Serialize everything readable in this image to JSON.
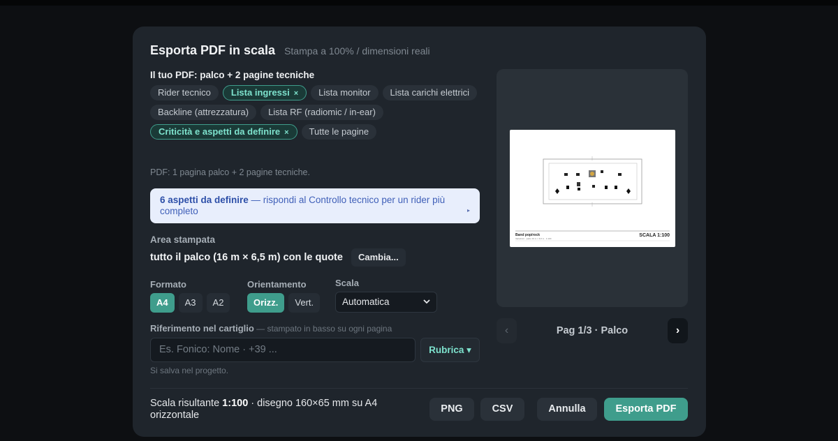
{
  "dialog": {
    "title": "Esporta PDF in scala",
    "subtitle": "Stampa a 100% / dimensioni reali",
    "pdf_section_label": "Il tuo PDF: palco + 2 pagine tecniche",
    "chips": [
      {
        "label": "Rider tecnico",
        "active": false
      },
      {
        "label": "Lista ingressi",
        "active": true
      },
      {
        "label": "Lista monitor",
        "active": false
      },
      {
        "label": "Lista carichi elettrici",
        "active": false
      },
      {
        "label": "Backline (attrezzatura)",
        "active": false
      },
      {
        "label": "Lista RF (radiomic / in-ear)",
        "active": false
      },
      {
        "label": "Criticità e aspetti da definire",
        "active": true
      },
      {
        "label": "Tutte le pagine",
        "active": false
      }
    ],
    "chip_remove_glyph": "×",
    "pdf_info": "PDF: 1 pagina palco + 2 pagine tecniche.",
    "alert": {
      "bold": "6 aspetti da definire",
      "text": " — rispondi al Controllo tecnico per un rider più completo",
      "arrow": "▸"
    },
    "area": {
      "label": "Area stampata",
      "value": "tutto il palco (16 m × 6,5 m) con le quote",
      "change_label": "Cambia..."
    },
    "format": {
      "label": "Formato",
      "options": [
        "A4",
        "A3",
        "A2"
      ],
      "selected": "A4"
    },
    "orientation": {
      "label": "Orientamento",
      "options": [
        "Orizz.",
        "Vert."
      ],
      "selected": "Orizz."
    },
    "scale": {
      "label": "Scala",
      "value": "Automatica"
    },
    "reference": {
      "label": "Riferimento nel cartiglio",
      "hint": " — stampato in basso su ogni pagina",
      "placeholder": "Es. Fonico: Nome · +39 ...",
      "rubrica_label": "Rubrica ▾",
      "save_note": "Si salva nel progetto."
    },
    "preview": {
      "sheet_title": "Band pop/rock",
      "sheet_sub": "Variazioni · palco 16 m × 6,5 m · 1:100",
      "sheet_scale": "SCALA 1:100"
    },
    "pager": {
      "prev": "‹",
      "next": "›",
      "text": "Pag 1/3 · Palco"
    },
    "footer": {
      "prefix": "Scala risultante ",
      "scale_bold": "1:100",
      "suffix": " · disegno 160×65 mm su A4 orizzontale",
      "png": "PNG",
      "csv": "CSV",
      "cancel": "Annulla",
      "export": "Esporta PDF"
    },
    "colors": {
      "accent": "#3f9d8c",
      "accent_text": "#7ee2cd",
      "alert_bg": "#e8eefc"
    }
  }
}
